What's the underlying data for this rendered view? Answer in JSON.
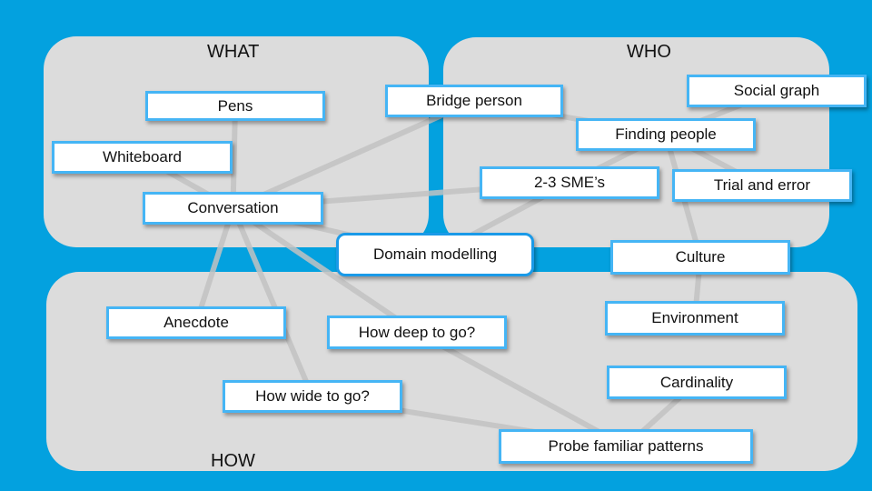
{
  "colors": {
    "background": "#03a1df",
    "region": "#dcdcdc",
    "node_border": "#45b5f5",
    "edge": "#c2c2c2"
  },
  "regions": {
    "what": "WHAT",
    "who": "WHO",
    "how": "HOW"
  },
  "nodes": {
    "pens": "Pens",
    "whiteboard": "Whiteboard",
    "conversation": "Conversation",
    "bridge_person": "Bridge person",
    "social_graph": "Social graph",
    "finding_people": "Finding people",
    "smes": "2-3 SME’s",
    "trial_and_error": "Trial and error",
    "domain_modelling": "Domain modelling",
    "culture": "Culture",
    "anecdote": "Anecdote",
    "how_deep": "How deep to go?",
    "environment": "Environment",
    "cardinality": "Cardinality",
    "how_wide": "How wide to go?",
    "probe_patterns": "Probe familiar patterns"
  },
  "edges": [
    [
      "pens",
      "conversation"
    ],
    [
      "whiteboard",
      "conversation"
    ],
    [
      "conversation",
      "bridge_person"
    ],
    [
      "conversation",
      "smes"
    ],
    [
      "conversation",
      "domain_modelling"
    ],
    [
      "conversation",
      "anecdote"
    ],
    [
      "conversation",
      "how_wide"
    ],
    [
      "conversation",
      "how_deep"
    ],
    [
      "bridge_person",
      "finding_people"
    ],
    [
      "social_graph",
      "finding_people"
    ],
    [
      "finding_people",
      "smes"
    ],
    [
      "finding_people",
      "trial_and_error"
    ],
    [
      "finding_people",
      "culture"
    ],
    [
      "smes",
      "domain_modelling"
    ],
    [
      "culture",
      "environment"
    ],
    [
      "how_deep",
      "probe_patterns"
    ],
    [
      "how_wide",
      "probe_patterns"
    ],
    [
      "cardinality",
      "probe_patterns"
    ]
  ]
}
